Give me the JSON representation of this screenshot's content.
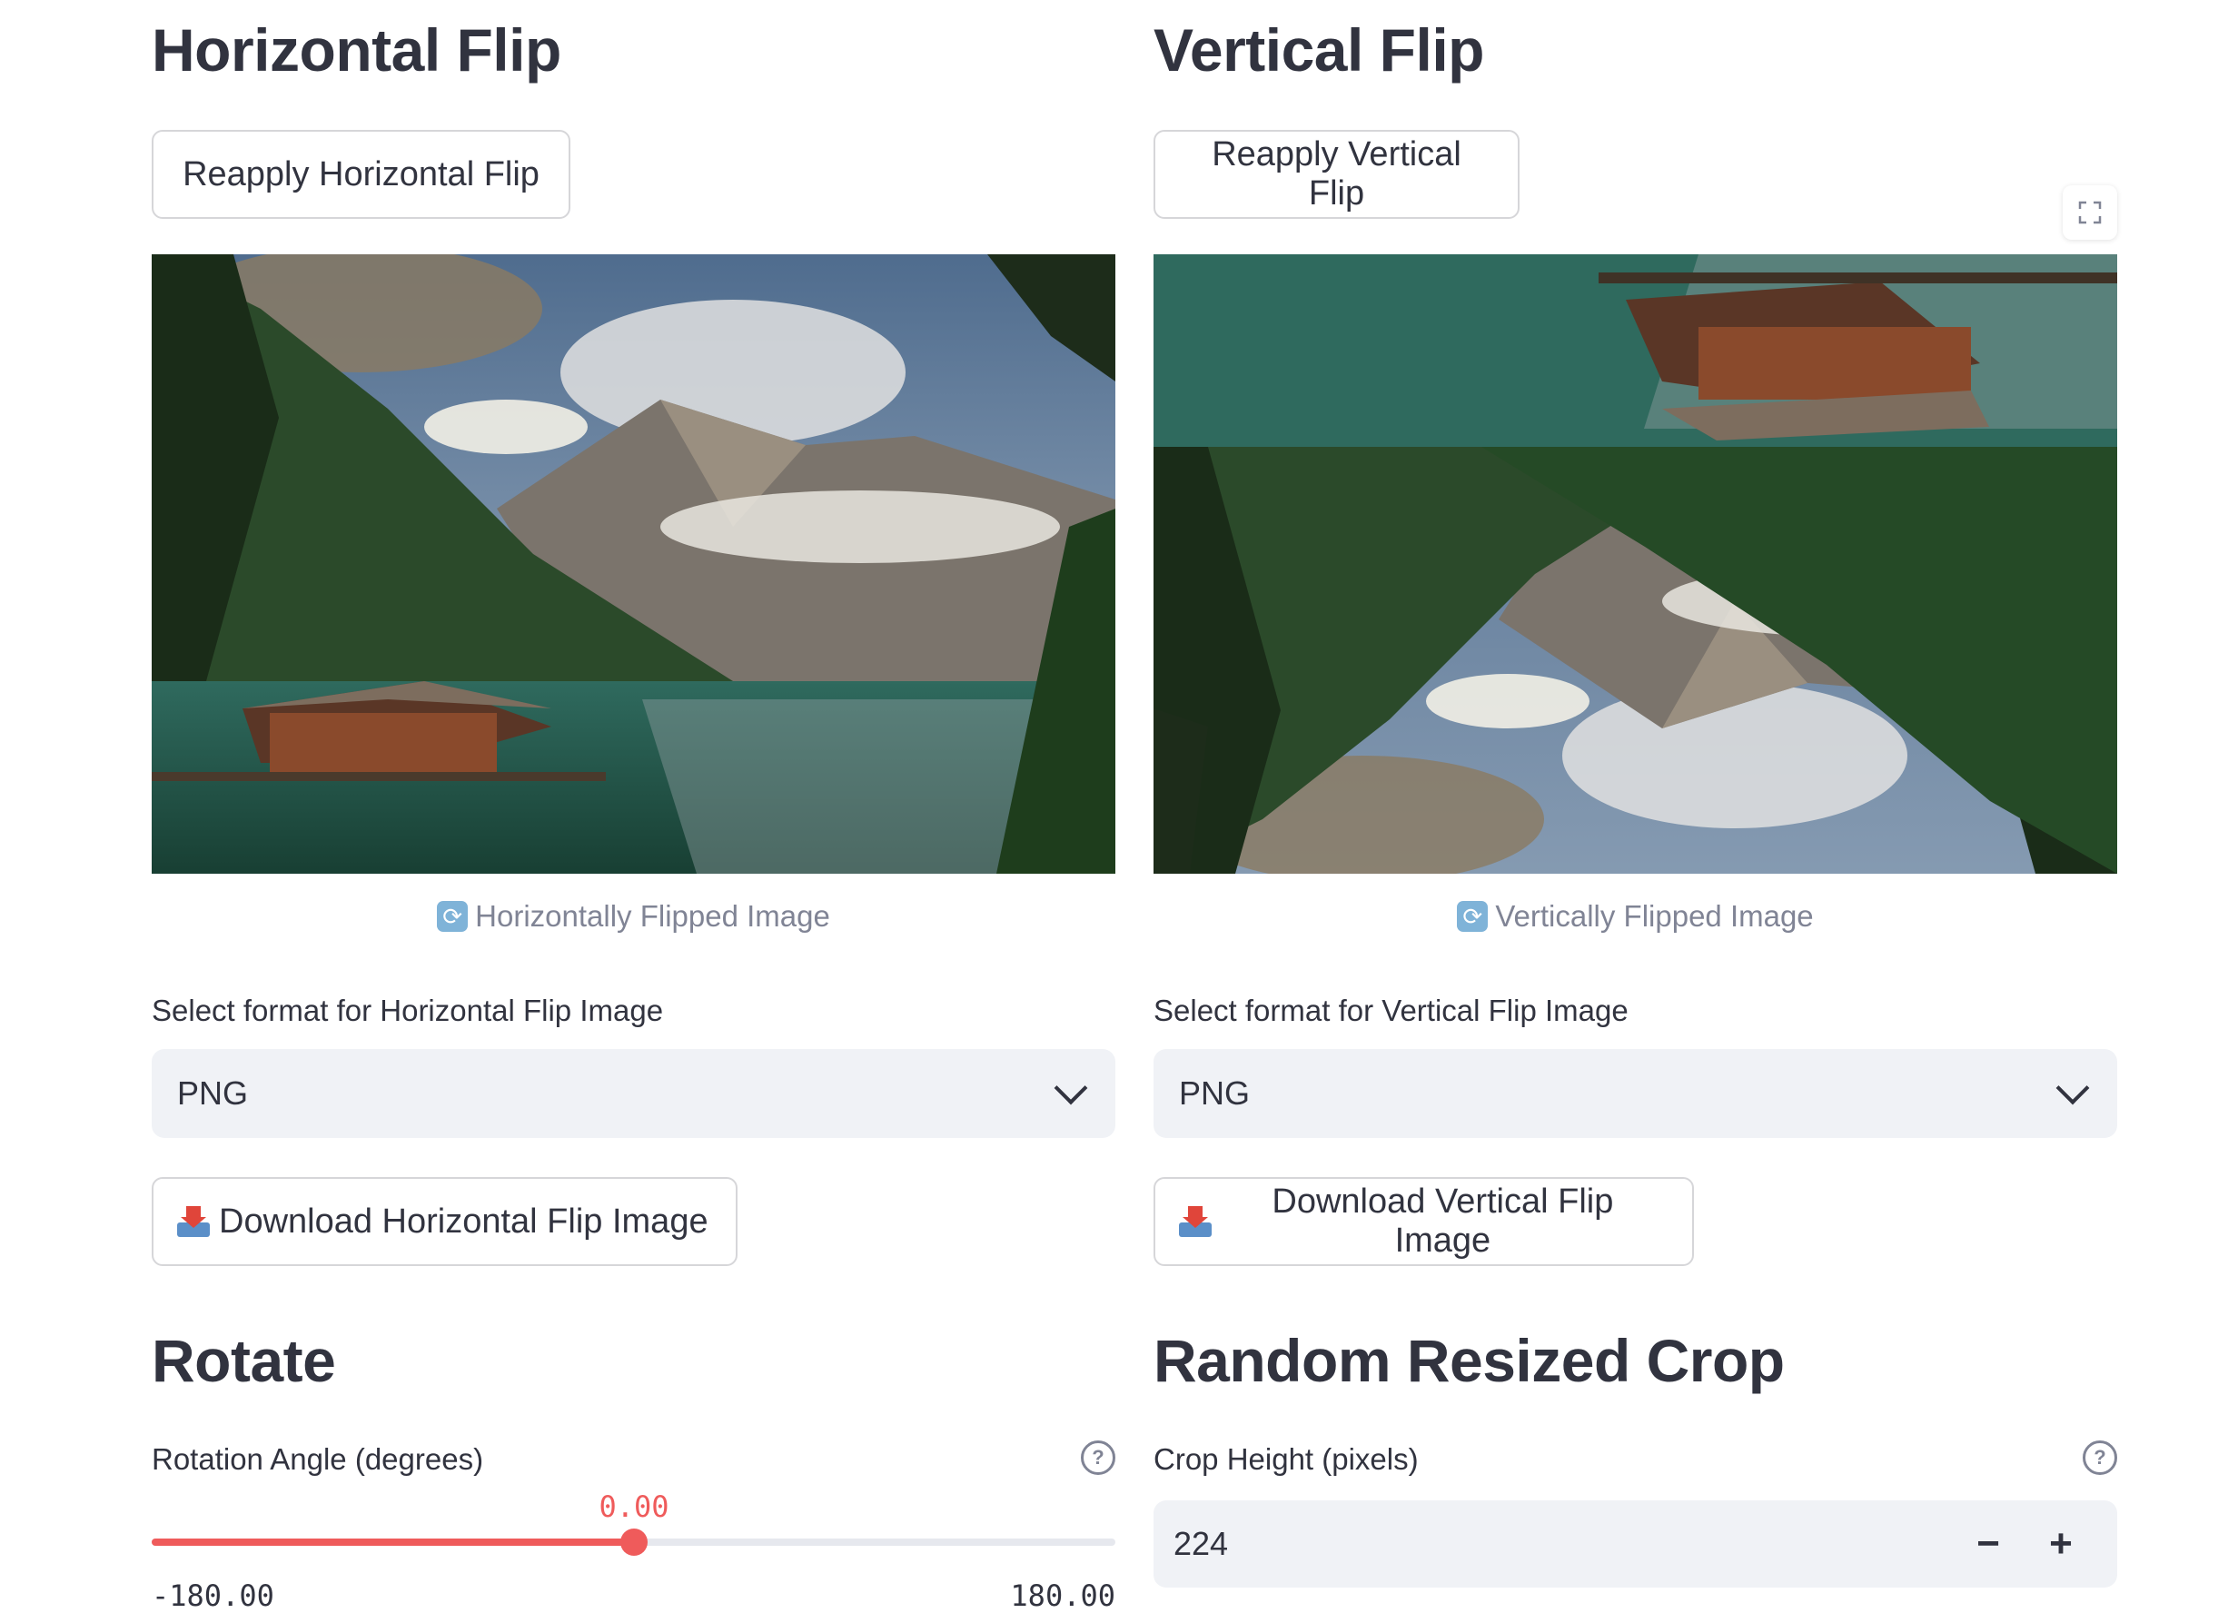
{
  "horizontal": {
    "title": "Horizontal Flip",
    "reapply_label": "Reapply Horizontal Flip",
    "caption": "Horizontally Flipped Image",
    "caption_icon": "repeat-icon",
    "format_label": "Select format for Horizontal Flip Image",
    "format_value": "PNG",
    "download_label": "Download Horizontal Flip Image"
  },
  "vertical": {
    "title": "Vertical Flip",
    "reapply_label": "Reapply Vertical Flip",
    "caption": "Vertically Flipped Image",
    "caption_icon": "repeat-icon",
    "format_label": "Select format for Vertical Flip Image",
    "format_value": "PNG",
    "download_label": "Download Vertical Flip Image"
  },
  "rotate": {
    "title": "Rotate",
    "label": "Rotation Angle (degrees)",
    "value": "0.00",
    "min": "-180.00",
    "max": "180.00",
    "fraction": 0.5,
    "accent": "#ef5b5b"
  },
  "crop": {
    "title": "Random Resized Crop",
    "label": "Crop Height (pixels)",
    "value": "224",
    "minus": "−",
    "plus": "+"
  },
  "colors": {
    "text": "#31333f",
    "muted": "#808495",
    "input_bg": "#f0f2f6",
    "accent": "#ef5b5b"
  }
}
